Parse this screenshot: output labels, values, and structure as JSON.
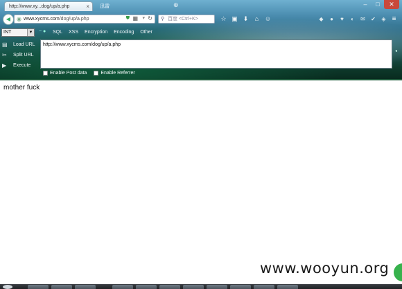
{
  "browser": {
    "tab_title": "http://www.xy...dog/up/a.php",
    "tab_close": "×",
    "second_tab_label": "迅雷",
    "url_prefix": "www.xycms.com",
    "url_rest": "/dog/up/a.php",
    "search_placeholder": "百度 <Ctrl+K>"
  },
  "hackbar": {
    "select_value": "INT",
    "menu": [
      "SQL",
      "XSS",
      "Encryption",
      "Encoding",
      "Other"
    ],
    "buttons": [
      "Load URL",
      "Split URL",
      "Execute"
    ],
    "url_value": "http://www.xycms.com/dog/up/a.php",
    "options": [
      "Enable Post data",
      "Enable Referrer"
    ]
  },
  "page": {
    "body_text": "mother fuck",
    "watermark": "www.wooyun.org"
  }
}
